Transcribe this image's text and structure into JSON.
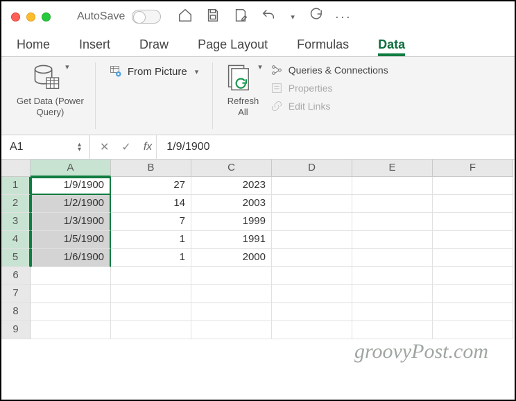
{
  "titlebar": {
    "autosave_label": "AutoSave",
    "more_label": "···"
  },
  "tabs": [
    "Home",
    "Insert",
    "Draw",
    "Page Layout",
    "Formulas",
    "Data"
  ],
  "active_tab": "Data",
  "ribbon": {
    "get_data": "Get Data (Power\nQuery)",
    "from_picture": "From Picture",
    "refresh_all": "Refresh\nAll",
    "queries": "Queries & Connections",
    "properties": "Properties",
    "edit_links": "Edit Links"
  },
  "formula_bar": {
    "name_box": "A1",
    "fx_value": "1/9/1900"
  },
  "columns": [
    "A",
    "B",
    "C",
    "D",
    "E",
    "F"
  ],
  "rows": [
    "1",
    "2",
    "3",
    "4",
    "5",
    "6",
    "7",
    "8",
    "9"
  ],
  "selected_column": "A",
  "active_cell": "A1",
  "data": {
    "A": [
      "1/9/1900",
      "1/2/1900",
      "1/3/1900",
      "1/5/1900",
      "1/6/1900",
      "",
      "",
      "",
      ""
    ],
    "B": [
      "27",
      "14",
      "7",
      "1",
      "1",
      "",
      "",
      "",
      ""
    ],
    "C": [
      "2023",
      "2003",
      "1999",
      "1991",
      "2000",
      "",
      "",
      "",
      ""
    ],
    "D": [
      "",
      "",
      "",
      "",
      "",
      "",
      "",
      "",
      ""
    ],
    "E": [
      "",
      "",
      "",
      "",
      "",
      "",
      "",
      "",
      ""
    ],
    "F": [
      "",
      "",
      "",
      "",
      "",
      "",
      "",
      "",
      ""
    ]
  },
  "watermark": "groovyPost.com"
}
